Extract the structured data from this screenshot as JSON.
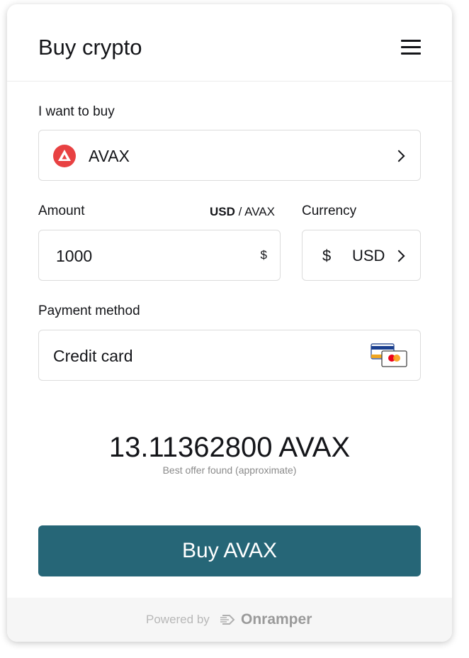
{
  "header": {
    "title": "Buy crypto",
    "menu_icon": "hamburger-menu-icon"
  },
  "asset": {
    "label": "I want to buy",
    "symbol": "AVAX",
    "icon": "avalanche-logo-icon",
    "icon_color": "#e84142"
  },
  "amount": {
    "label": "Amount",
    "toggle_active": "USD",
    "toggle_separator": " / ",
    "toggle_other": "AVAX",
    "value": "1000",
    "suffix_symbol": "$"
  },
  "currency": {
    "label": "Currency",
    "symbol": "$",
    "code": "USD"
  },
  "payment": {
    "label": "Payment method",
    "value": "Credit card",
    "icon": "credit-card-icon"
  },
  "quote": {
    "amount": "13.11362800 AVAX",
    "note": "Best offer found (approximate)"
  },
  "buy_button": {
    "label": "Buy AVAX",
    "color": "#266677"
  },
  "footer": {
    "powered_by": "Powered by",
    "brand": "Onramper"
  }
}
